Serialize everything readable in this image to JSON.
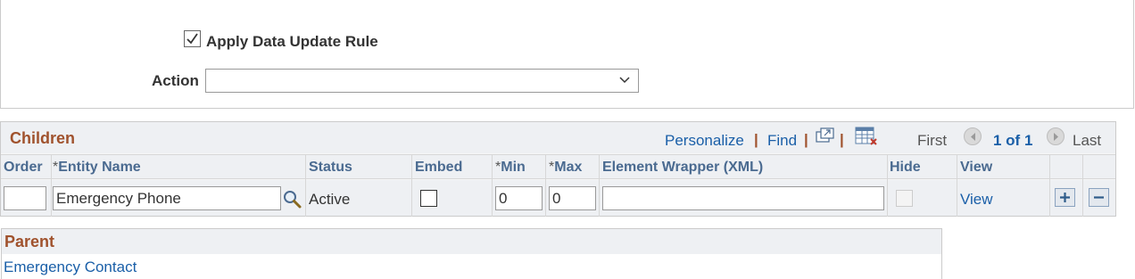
{
  "top": {
    "apply_rule_label": "Apply Data Update Rule",
    "apply_rule_checked": true,
    "action_label": "Action",
    "action_value": ""
  },
  "children": {
    "title": "Children",
    "toolbar": {
      "personalize": "Personalize",
      "find": "Find",
      "separator": "|",
      "first": "First",
      "count": "1 of 1",
      "last": "Last"
    },
    "columns": {
      "order": "Order",
      "req": "*",
      "entity_name": "Entity Name",
      "status": "Status",
      "embed": "Embed",
      "min": "Min",
      "max": "Max",
      "element_wrapper": "Element Wrapper (XML)",
      "hide": "Hide",
      "view": "View"
    },
    "rows": [
      {
        "order": "",
        "entity_name": "Emergency Phone",
        "status": "Active",
        "embed": false,
        "min": "0",
        "max": "0",
        "element_wrapper": "",
        "hide": false,
        "view": "View"
      }
    ]
  },
  "parent": {
    "title": "Parent",
    "link": "Emergency Contact"
  },
  "colors": {
    "section_title": "#a0522d",
    "link": "#1a5fa8",
    "column_header": "#4a6a90",
    "header_bg": "#eef0f3"
  }
}
